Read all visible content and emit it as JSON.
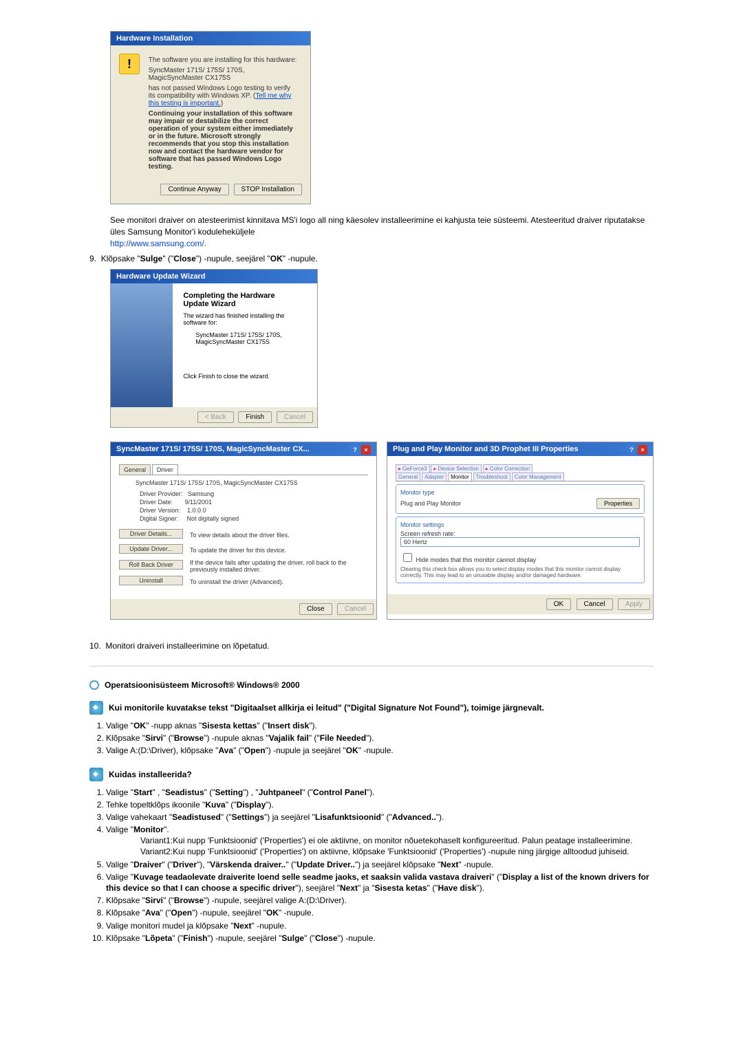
{
  "dialog1": {
    "title": "Hardware Installation",
    "line1": "The software you are installing for this hardware:",
    "line2": "SyncMaster 171S/ 175S/ 170S, MagicSyncMaster CX175S",
    "line3a": "has not passed Windows Logo testing to verify its compatibility with Windows XP. (",
    "link": "Tell me why this testing is important.",
    "line3b": ")",
    "warn": "Continuing your installation of this software may impair or destabilize the correct operation of your system either immediately or in the future. Microsoft strongly recommends that you stop this installation now and contact the hardware vendor for software that has passed Windows Logo testing.",
    "btn_continue": "Continue Anyway",
    "btn_stop": "STOP Installation"
  },
  "paragraph1": "See monitori draiver on atesteerimist kinnitava MS'i logo all ning käesolev installeerimine ei kahjusta teie süsteemi. Atesteeritud draiver riputatakse üles Samsung Monitor'i koduleheküljele",
  "samsung_url": "http://www.samsung.com/.",
  "step9_prefix": "9.",
  "step9_text_1": "Klõpsake \"",
  "step9_bold1": "Sulge",
  "step9_text_2": "\" (\"",
  "step9_bold2": "Close",
  "step9_text_3": "\") -nupule, seejärel \"",
  "step9_bold3": "OK",
  "step9_text_4": "\" -nupule.",
  "dialog2": {
    "title": "Hardware Update Wizard",
    "heading": "Completing the Hardware Update Wizard",
    "sub": "The wizard has finished installing the software for:",
    "device": "SyncMaster 171S/ 175S/ 170S, MagicSyncMaster CX175S",
    "footer": "Click Finish to close the wizard.",
    "back": "< Back",
    "finish": "Finish",
    "cancel": "Cancel"
  },
  "dialog3": {
    "title": "SyncMaster 171S/ 175S/ 170S, MagicSyncMaster CX...",
    "tab_general": "General",
    "tab_driver": "Driver",
    "device": "SyncMaster 171S/ 175S/ 170S, MagicSyncMaster CX175S",
    "prov_lbl": "Driver Provider:",
    "prov_val": "Samsung",
    "date_lbl": "Driver Date:",
    "date_val": "9/11/2001",
    "ver_lbl": "Driver Version:",
    "ver_val": "1.0.0.0",
    "sig_lbl": "Digital Signer:",
    "sig_val": "Not digitally signed",
    "b1": "Driver Details...",
    "b1d": "To view details about the driver files.",
    "b2": "Update Driver...",
    "b2d": "To update the driver for this device.",
    "b3": "Roll Back Driver",
    "b3d": "If the device fails after updating the driver, roll back to the previously installed driver.",
    "b4": "Uninstall",
    "b4d": "To uninstall the driver (Advanced).",
    "close": "Close",
    "cancel": "Cancel"
  },
  "dialog4": {
    "title": "Plug and Play Monitor and 3D Prophet III Properties",
    "tabs_top": [
      "GeForce3",
      "Device Selection",
      "Color Correction"
    ],
    "tabs_bot": [
      "General",
      "Adapter",
      "Monitor",
      "Troubleshoot",
      "Color Management"
    ],
    "group1": "Monitor type",
    "mon_name": "Plug and Play Monitor",
    "props_btn": "Properties",
    "group2": "Monitor settings",
    "refresh_lbl": "Screen refresh rate:",
    "refresh_val": "60 Hertz",
    "cb_lbl": "Hide modes that this monitor cannot display",
    "cb_desc": "Clearing this check box allows you to select display modes that this monitor cannot display correctly. This may lead to an unusable display and/or damaged hardware.",
    "ok": "OK",
    "cancel": "Cancel",
    "apply": "Apply"
  },
  "step10": "Monitori draiveri installeerimine on lõpetatud.",
  "os_heading": "Operatsioonisüsteem Microsoft® Windows® 2000",
  "sig_section": {
    "heading": "Kui monitorile kuvatakse tekst \"Digitaalset allkirja ei leitud\" (\"Digital Signature Not Found\"), toimige järgnevalt.",
    "li1": "Valige \"OK\" -nupp aknas \"Sisesta kettas\" (\"Insert disk\").",
    "li2": "Klõpsake \"Sirvi\" (\"Browse\") -nupule aknas \"Vajalik fail\" (\"File Needed\").",
    "li3": "Valige A:(D:\\Driver), klõpsake \"Ava\" (\"Open\") -nupule ja seejärel \"OK\" -nupule."
  },
  "install_heading": "Kuidas installeerida?",
  "install": {
    "li1": "Valige \"Start\" , \"Seadistus\" (\"Setting\") , \"Juhtpaneel\" (\"Control Panel\").",
    "li2": "Tehke topeltklõps ikoonile \"Kuva\" (\"Display\").",
    "li3": "Valige vahekaart \"Seadistused\" (\"Settings\") ja seejärel \"Lisafunktsioonid\" (\"Advanced..\").",
    "li4": "Valige \"Monitor\".",
    "v1": "Variant1:Kui nupp 'Funktsioonid' ('Properties') ei ole aktiivne, on monitor nõuetekohaselt konfigureeritud. Palun peatage installeerimine.",
    "v2": "Variant2:Kui nupp 'Funktsioonid' ('Properties') on aktiivne, klõpsake 'Funktsioonid' ('Properties') -nupule ning järgige alltoodud juhiseid.",
    "li5": "Valige \"Draiver\" (\"Driver\"), \"Värskenda draiver..\" (\"Update Driver..\") ja seejärel klõpsake \"Next\" -nupule.",
    "li6": "Valige \"Kuvage teadaolevate draiverite loend selle seadme jaoks, et saaksin valida vastava draiveri\" (\"Display a list of the known drivers for this device so that I can choose a specific driver\"), seejärel \"Next\" ja \"Sisesta ketas\" (\"Have disk\").",
    "li7": "Klõpsake \"Sirvi\" (\"Browse\") -nupule, seejärel valige A:(D:\\Driver).",
    "li8": "Klõpsake \"Ava\" (\"Open\") -nupule, seejärel \"OK\" -nupule.",
    "li9": "Valige monitori mudel ja klõpsake \"Next\" -nupule.",
    "li10": "Klõpsake \"Lõpeta\" (\"Finish\") -nupule, seejärel \"Sulge\" (\"Close\") -nupule."
  }
}
